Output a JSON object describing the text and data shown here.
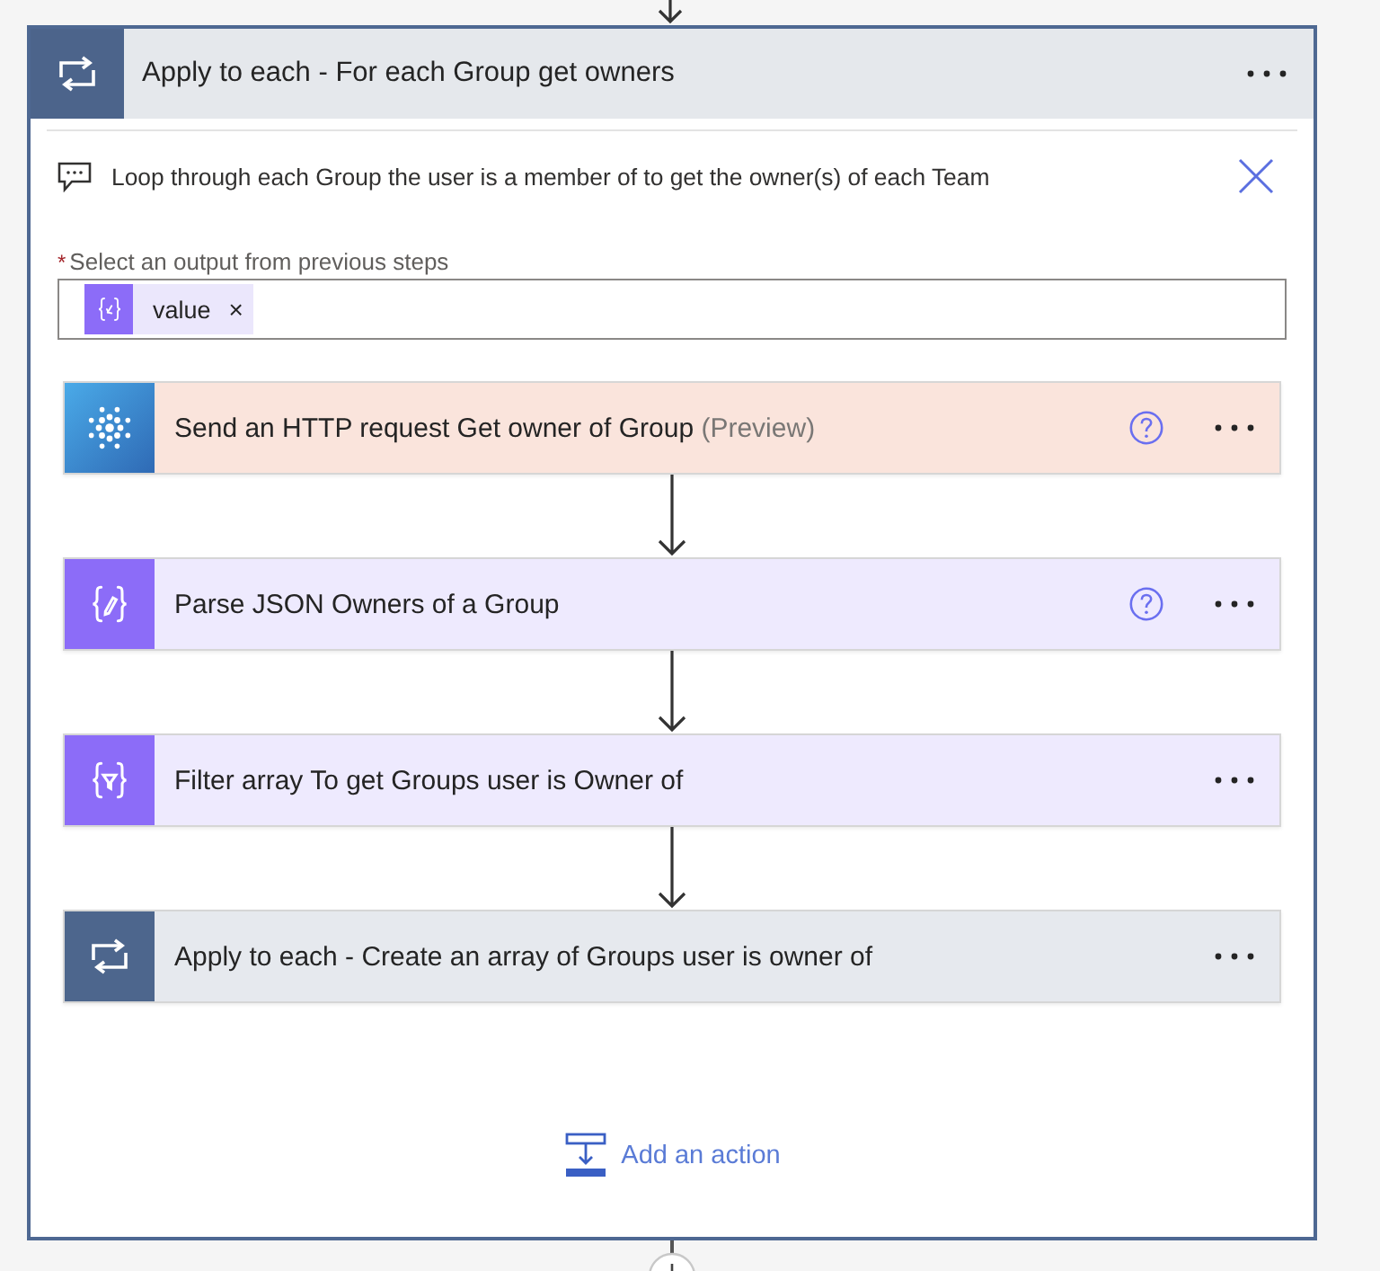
{
  "loop": {
    "title": "Apply to each - For each Group get owners",
    "comment": "Loop through each Group the user is a member of to get the owner(s) of each Team",
    "output": {
      "required_mark": "*",
      "label": "Select an output from previous steps",
      "tokens": [
        {
          "label": "value",
          "remove": "×"
        }
      ]
    },
    "actions": [
      {
        "kind": "http",
        "title": "Send an HTTP request Get owner of Group",
        "note": "(Preview)",
        "help": true
      },
      {
        "kind": "parse_json",
        "title": "Parse JSON Owners of a Group",
        "help": true
      },
      {
        "kind": "filter_array",
        "title": "Filter array To get Groups user is Owner of",
        "help": false
      },
      {
        "kind": "apply_to_each",
        "title": "Apply to each - Create an array of Groups user is owner of",
        "help": false
      }
    ],
    "add_action": "Add an action"
  }
}
